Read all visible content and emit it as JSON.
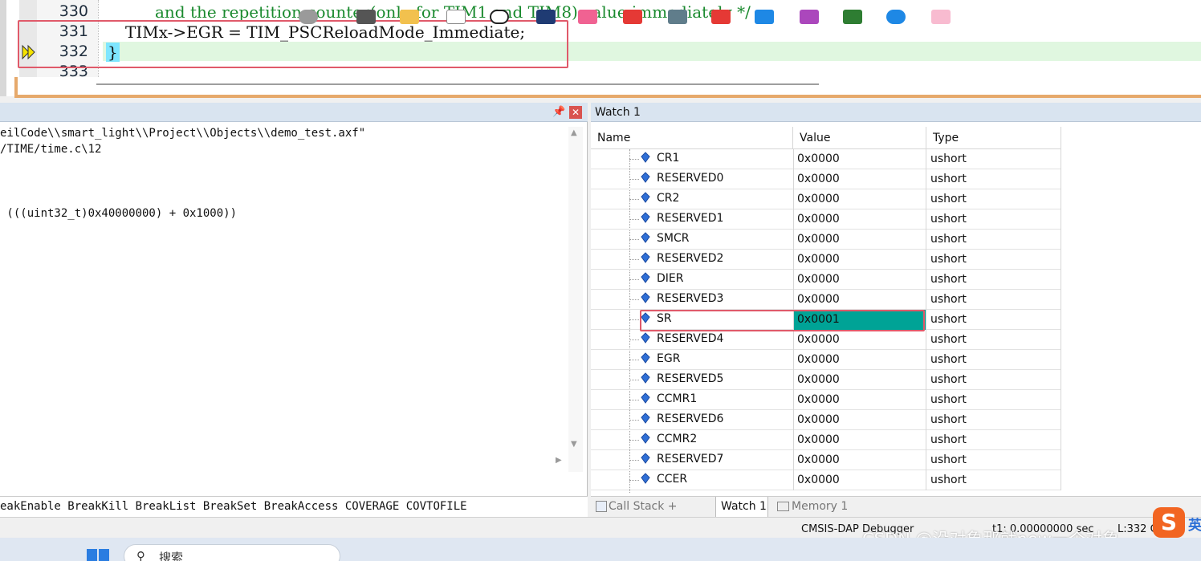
{
  "editor": {
    "lines": [
      {
        "num": "330",
        "text": "and the repetition counter(only for TIM1 and TIM8) value immediately */"
      },
      {
        "num": "331",
        "text": "TIMx->EGR = TIM_PSCReloadMode_Immediate;"
      },
      {
        "num": "332",
        "text": "}"
      },
      {
        "num": "333",
        "text": ""
      }
    ]
  },
  "command": {
    "lines": [
      "eilCode\\\\smart_light\\\\Project\\\\Objects\\\\demo_test.axf\"",
      "/TIME/time.c\\12",
      " (((uint32_t)0x40000000) + 0x1000))"
    ],
    "keywords": "eakEnable BreakKill BreakList BreakSet BreakAccess COVERAGE COVTOFILE"
  },
  "watch": {
    "title": "Watch 1",
    "columns": [
      "Name",
      "Value",
      "Type"
    ],
    "rows": [
      {
        "name": "CR1",
        "value": "0x0000",
        "type": "ushort"
      },
      {
        "name": "RESERVED0",
        "value": "0x0000",
        "type": "ushort"
      },
      {
        "name": "CR2",
        "value": "0x0000",
        "type": "ushort"
      },
      {
        "name": "RESERVED1",
        "value": "0x0000",
        "type": "ushort"
      },
      {
        "name": "SMCR",
        "value": "0x0000",
        "type": "ushort"
      },
      {
        "name": "RESERVED2",
        "value": "0x0000",
        "type": "ushort"
      },
      {
        "name": "DIER",
        "value": "0x0000",
        "type": "ushort"
      },
      {
        "name": "RESERVED3",
        "value": "0x0000",
        "type": "ushort"
      },
      {
        "name": "SR",
        "value": "0x0001",
        "type": "ushort",
        "changed": true
      },
      {
        "name": "RESERVED4",
        "value": "0x0000",
        "type": "ushort"
      },
      {
        "name": "EGR",
        "value": "0x0000",
        "type": "ushort"
      },
      {
        "name": "RESERVED5",
        "value": "0x0000",
        "type": "ushort"
      },
      {
        "name": "CCMR1",
        "value": "0x0000",
        "type": "ushort"
      },
      {
        "name": "RESERVED6",
        "value": "0x0000",
        "type": "ushort"
      },
      {
        "name": "CCMR2",
        "value": "0x0000",
        "type": "ushort"
      },
      {
        "name": "RESERVED7",
        "value": "0x0000",
        "type": "ushort"
      },
      {
        "name": "CCER",
        "value": "0x0000",
        "type": "ushort"
      }
    ],
    "changed_color": "#00a396"
  },
  "tabs": [
    {
      "label": "Call Stack + Locals",
      "icon": "call-stack-icon"
    },
    {
      "label": "Watch 1",
      "active": true
    },
    {
      "label": "Memory 1",
      "icon": "memory-icon"
    }
  ],
  "status": {
    "debugger": "CMSIS-DAP Debugger",
    "time": "t1: 0.00000000 sec",
    "position": "L:332 C:"
  },
  "watermark": "CSDN @没对象那就new一个对象",
  "taskbar": {
    "search_label": "搜索",
    "ime_label": "英"
  },
  "colors": {
    "accent_red_box": "#e05a6a",
    "panel_title": "#d9e4f0",
    "current_line": "#e0f7e0"
  }
}
